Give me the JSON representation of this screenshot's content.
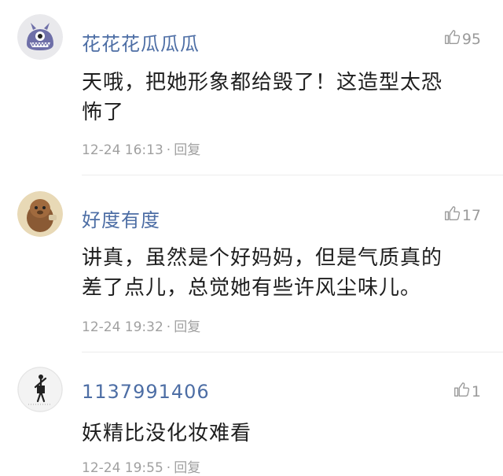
{
  "comments": [
    {
      "username": "花花花瓜瓜瓜",
      "likes": "95",
      "text_lines": [
        "天哦，把她形象都给毁了！这造型太恐",
        "怖了"
      ],
      "time": "12-24 16:13",
      "dot": "·",
      "reply": "回复",
      "avatar": "monster-avatar"
    },
    {
      "username": "好度有度",
      "likes": "17",
      "text_lines": [
        "讲真，虽然是个好妈妈，但是气质真的",
        "差了点儿，总觉她有些许风尘味儿。"
      ],
      "time": "12-24 19:32",
      "dot": "·",
      "reply": "回复",
      "avatar": "cartoon-avatar"
    },
    {
      "username": "1137991406",
      "likes": "1",
      "text_lines": [
        "妖精比没化妆难看"
      ],
      "time": "12-24 19:55",
      "dot": "·",
      "reply": "回复",
      "avatar": "figure-avatar"
    }
  ],
  "colors": {
    "username": "#4d6ea5",
    "meta": "#a0a0a0",
    "text": "#1e1e1e"
  },
  "icons": {
    "like": "thumbs-up-icon"
  }
}
